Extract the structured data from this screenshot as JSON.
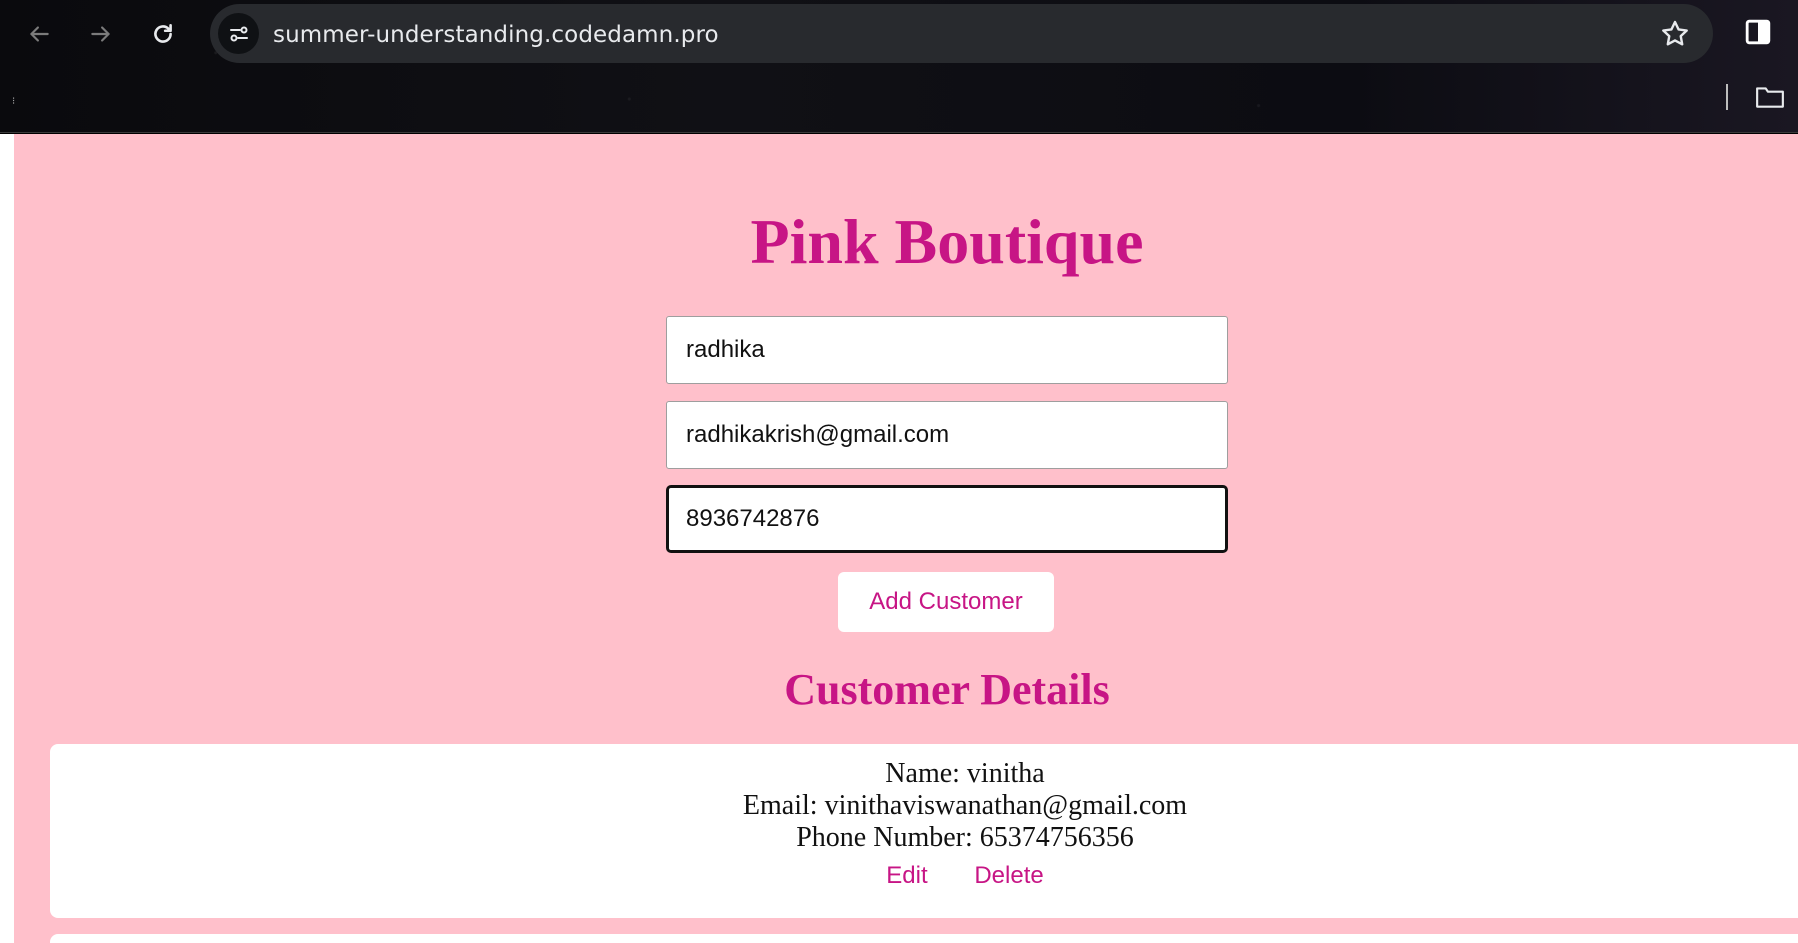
{
  "browser": {
    "url": "summer-understanding.codedamn.pro",
    "icons": [
      "back-arrow-icon",
      "forward-arrow-icon",
      "reload-icon",
      "site-info-icon",
      "bookmark-star-icon",
      "side-panel-icon",
      "folder-icon"
    ]
  },
  "page": {
    "title": "Pink Boutique",
    "form": {
      "name_value": "radhika",
      "email_value": "radhikakrish@gmail.com",
      "phone_value": "8936742876",
      "add_button": "Add Customer"
    },
    "section_title": "Customer Details",
    "customers": [
      {
        "name_line": "Name: vinitha",
        "email_line": "Email: vinithaviswanathan@gmail.com",
        "phone_line": "Phone Number: 65374756356",
        "edit_label": "Edit",
        "delete_label": "Delete"
      }
    ],
    "colors": {
      "background": "#ffc0cb",
      "accent": "#c71585",
      "card": "#ffffff"
    }
  }
}
